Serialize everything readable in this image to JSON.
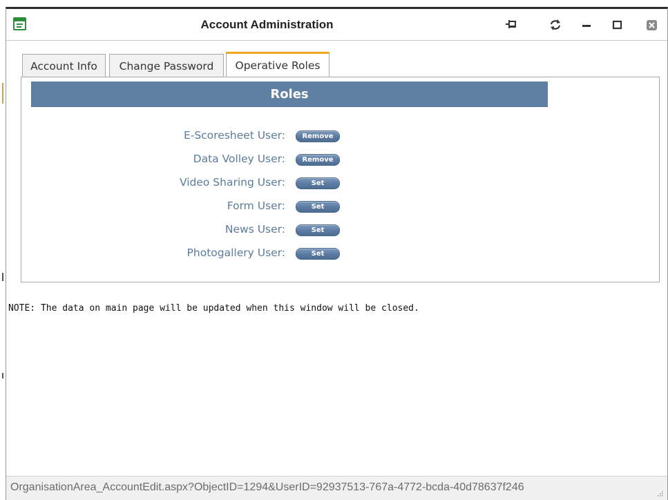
{
  "window": {
    "title": "Account Administration"
  },
  "tabs": [
    {
      "label": "Account Info",
      "active": false
    },
    {
      "label": "Change Password",
      "active": false
    },
    {
      "label": "Operative Roles",
      "active": true
    }
  ],
  "roles": {
    "header": "Roles",
    "items": [
      {
        "label": "E-Scoresheet User:",
        "action": "Remove"
      },
      {
        "label": "Data Volley User:",
        "action": "Remove"
      },
      {
        "label": "Video Sharing User:",
        "action": "Set"
      },
      {
        "label": "Form User:",
        "action": "Set"
      },
      {
        "label": "News User:",
        "action": "Set"
      },
      {
        "label": "Photogallery User:",
        "action": "Set"
      }
    ]
  },
  "note": "NOTE: The data on main page will be updated when this window will be closed.",
  "status": {
    "url": "OrganisationArea_AccountEdit.aspx?ObjectID=1294&UserID=92937513-767a-4772-bcda-40d78637f246"
  },
  "colors": {
    "accent_tab": "#f0a91e",
    "header_bg": "#5f7fa3",
    "label_text": "#5a7b9c",
    "button_bg": "#5a7aa0"
  },
  "icons": {
    "app": "form-icon",
    "pin": "pin-icon",
    "refresh": "refresh-icon",
    "minimize": "minimize-icon",
    "maximize": "maximize-icon",
    "close": "close-icon"
  }
}
